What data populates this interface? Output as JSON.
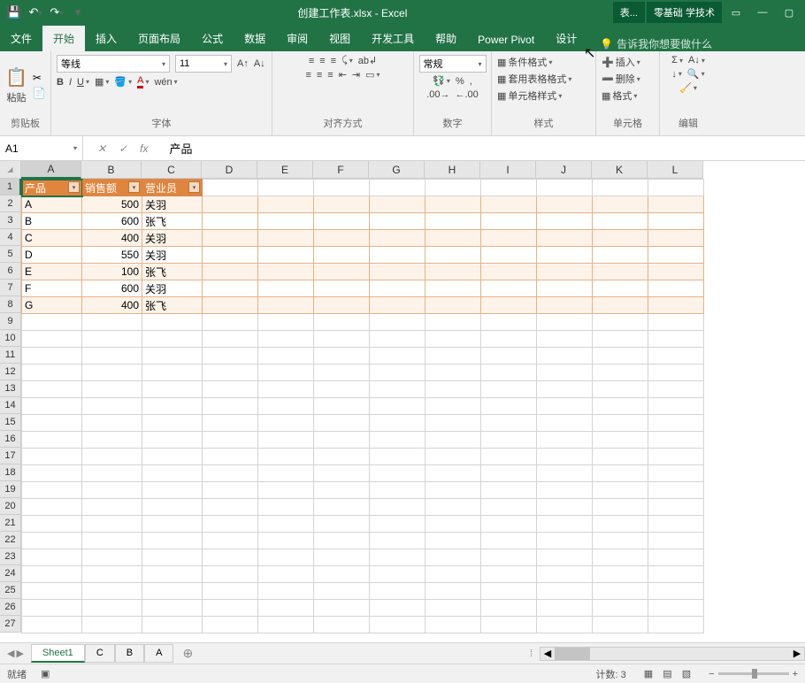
{
  "titlebar": {
    "title": "创建工作表.xlsx - Excel",
    "context_tab": "表...",
    "right_label": "零基础 学技术"
  },
  "tabs": [
    "文件",
    "开始",
    "插入",
    "页面布局",
    "公式",
    "数据",
    "审阅",
    "视图",
    "开发工具",
    "帮助",
    "Power Pivot",
    "设计"
  ],
  "tell_me": "告诉我你想要做什么",
  "ribbon": {
    "clipboard": {
      "label": "剪贴板",
      "paste": "粘贴"
    },
    "font": {
      "label": "字体",
      "name": "等线",
      "size": "11"
    },
    "alignment": {
      "label": "对齐方式"
    },
    "number": {
      "label": "数字",
      "format": "常规"
    },
    "styles": {
      "label": "样式",
      "cond": "条件格式",
      "table": "套用表格格式",
      "cell": "单元格样式"
    },
    "cells": {
      "label": "单元格",
      "insert": "插入",
      "delete": "删除",
      "format": "格式"
    },
    "editing": {
      "label": "编辑"
    }
  },
  "namebox": "A1",
  "formula": "产品",
  "columns": [
    "A",
    "B",
    "C",
    "D",
    "E",
    "F",
    "G",
    "H",
    "I",
    "J",
    "K",
    "L"
  ],
  "rows": [
    1,
    2,
    3,
    4,
    5,
    6,
    7,
    8,
    9,
    10,
    11,
    12,
    13,
    14,
    15,
    16,
    17,
    18,
    19,
    20,
    21,
    22,
    23,
    24,
    25,
    26,
    27
  ],
  "table_headers": [
    "产品",
    "销售额",
    "营业员"
  ],
  "table_data": [
    {
      "p": "A",
      "s": 500,
      "y": "关羽"
    },
    {
      "p": "B",
      "s": 600,
      "y": "张飞"
    },
    {
      "p": "C",
      "s": 400,
      "y": "关羽"
    },
    {
      "p": "D",
      "s": 550,
      "y": "关羽"
    },
    {
      "p": "E",
      "s": 100,
      "y": "张飞"
    },
    {
      "p": "F",
      "s": 600,
      "y": "关羽"
    },
    {
      "p": "G",
      "s": 400,
      "y": "张飞"
    }
  ],
  "sheets": [
    "Sheet1",
    "C",
    "B",
    "A"
  ],
  "status": {
    "ready": "就绪",
    "count_lbl": "计数",
    "count_val": "3"
  }
}
